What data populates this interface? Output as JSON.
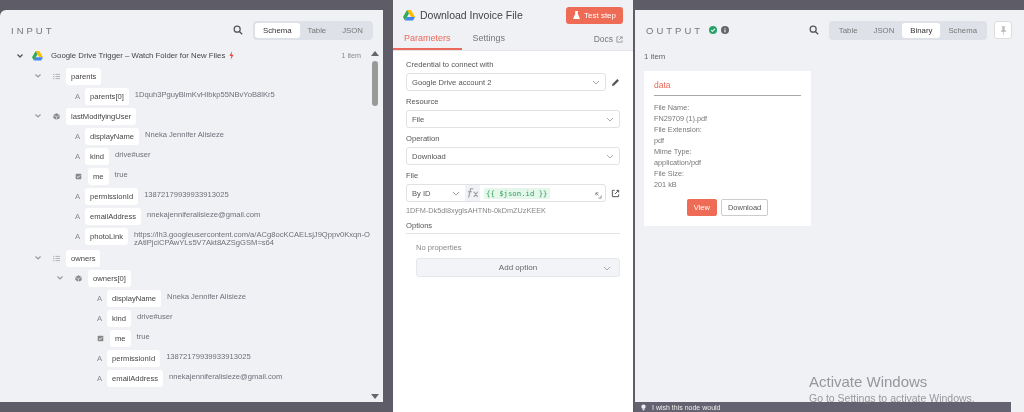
{
  "input": {
    "title": "INPUT",
    "view_tabs": [
      {
        "label": "Schema",
        "selected": true
      },
      {
        "label": "Table",
        "selected": false
      },
      {
        "label": "JSON",
        "selected": false
      }
    ],
    "source": {
      "name": "Google Drive Trigger – Watch Folder for New Files",
      "count": "1 item",
      "expanded": true,
      "fields": [
        {
          "kind": "array",
          "key": "parents",
          "expanded": true,
          "children": [
            {
              "kind": "string",
              "type_icon": "A",
              "key": "parents[0]",
              "value": "1Dquh3PguyBlmKvHIbkp55NBvYoB8lKr5"
            }
          ]
        },
        {
          "kind": "object",
          "key": "lastModifyingUser",
          "expanded": true,
          "children": [
            {
              "kind": "string",
              "type_icon": "A",
              "key": "displayName",
              "value": "Nneka Jennifer Alisieze"
            },
            {
              "kind": "string",
              "type_icon": "A",
              "key": "kind",
              "value": "drive#user"
            },
            {
              "kind": "boolean",
              "key": "me",
              "value": "true"
            },
            {
              "kind": "string",
              "type_icon": "A",
              "key": "permissionId",
              "value": "13872179939933913025"
            },
            {
              "kind": "string",
              "type_icon": "A",
              "key": "emailAddress",
              "value": "nnekajenniferalisieze@gmail.com"
            },
            {
              "kind": "string",
              "type_icon": "A",
              "key": "photoLink",
              "value": "https://lh3.googleusercontent.com/a/ACg8ocKCAELsjJ9Qppv0Kxqn-OzAtlPjciCPAwYLs5V7Akt8AZSgGSM=s64"
            }
          ]
        },
        {
          "kind": "array",
          "key": "owners",
          "expanded": true,
          "children": [
            {
              "kind": "object",
              "key": "owners[0]",
              "expanded": true,
              "children": [
                {
                  "kind": "string",
                  "type_icon": "A",
                  "key": "displayName",
                  "value": "Nneka Jennifer Alisieze"
                },
                {
                  "kind": "string",
                  "type_icon": "A",
                  "key": "kind",
                  "value": "drive#user"
                },
                {
                  "kind": "boolean",
                  "key": "me",
                  "value": "true"
                },
                {
                  "kind": "string",
                  "type_icon": "A",
                  "key": "permissionId",
                  "value": "13872179939933913025"
                },
                {
                  "kind": "string",
                  "type_icon": "A",
                  "key": "emailAddress",
                  "value": "nnekajenniferalisieze@gmail.com"
                }
              ]
            }
          ]
        }
      ]
    }
  },
  "node": {
    "title": "Download Invoice File",
    "test_button": "Test step",
    "tabs": [
      {
        "label": "Parameters",
        "selected": true
      },
      {
        "label": "Settings",
        "selected": false
      }
    ],
    "docs_link": "Docs",
    "credential": {
      "label": "Credential to connect with",
      "value": "Google Drive account 2"
    },
    "resource": {
      "label": "Resource",
      "value": "File"
    },
    "operation": {
      "label": "Operation",
      "value": "Download"
    },
    "file": {
      "label": "File",
      "mode": "By ID",
      "expression": "{{ $json.id }}",
      "resolved": "1DFM-Dk5dl8xyglsAHTNb-0kDmZUzKEEK"
    },
    "options": {
      "label": "Options",
      "empty": "No properties",
      "add_button": "Add option"
    }
  },
  "output": {
    "title": "OUTPUT",
    "view_tabs": [
      {
        "label": "Table",
        "selected": false
      },
      {
        "label": "JSON",
        "selected": false
      },
      {
        "label": "Binary",
        "selected": true
      },
      {
        "label": "Schema",
        "selected": false
      }
    ],
    "count": "1 item",
    "card": {
      "title": "data",
      "lines": [
        "File Name:",
        "FN29709 (1).pdf",
        "File Extension:",
        "pdf",
        "Mime Type:",
        "application/pdf",
        "File Size:",
        "201 kB"
      ],
      "view_button": "View",
      "download_button": "Download"
    },
    "feedback": "I wish this node would"
  },
  "os_notice": {
    "title": "Activate Windows",
    "subtitle": "Go to Settings to activate Windows."
  }
}
